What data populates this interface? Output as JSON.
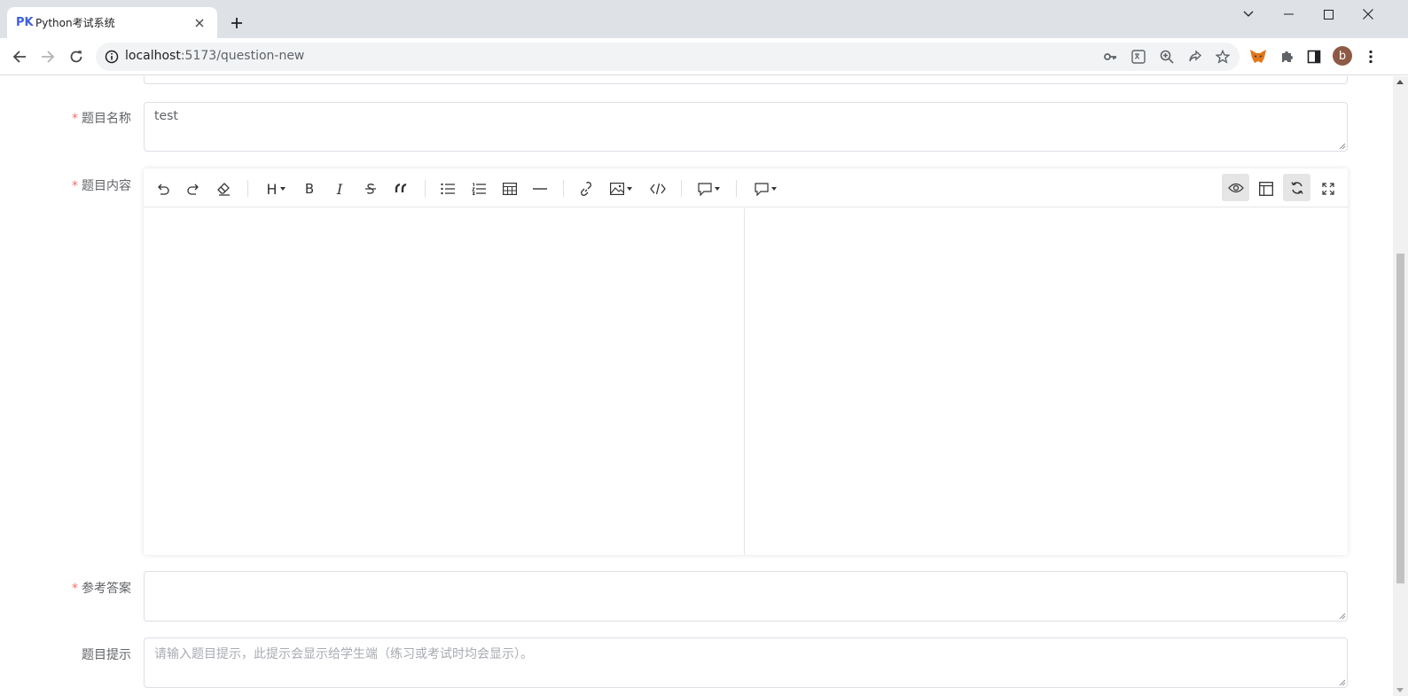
{
  "browser": {
    "tab_favicon": "PK",
    "tab_title": "Python考试系统",
    "url_host": "localhost",
    "url_path": ":5173/question-new",
    "profile_initial": "b"
  },
  "form": {
    "name_label": "题目名称",
    "name_value": "test",
    "content_label": "题目内容",
    "answer_label": "参考答案",
    "answer_value": "",
    "hint_label": "题目提示",
    "hint_placeholder": "请输入题目提示，此提示会显示给学生端（练习或考试时均会显示）。",
    "required_mark": "*"
  },
  "editor": {
    "heading_button": "H",
    "bold_button": "B",
    "italic_button": "I"
  }
}
